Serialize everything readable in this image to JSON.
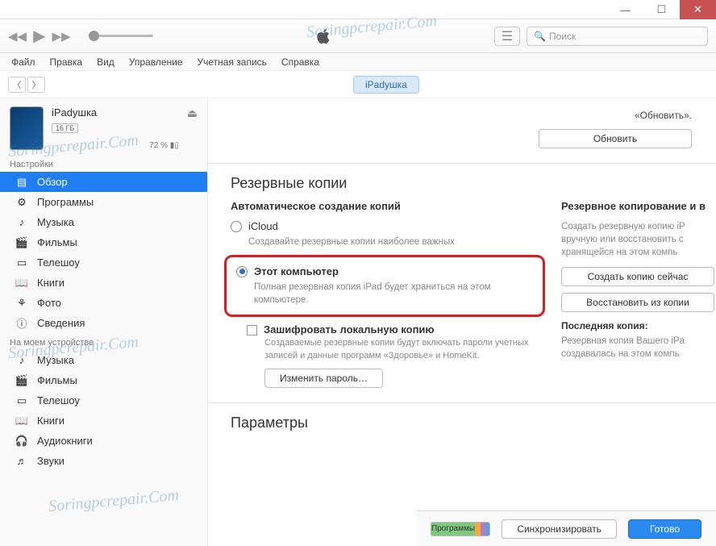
{
  "titlebar": {
    "min": "—",
    "max": "☐",
    "close": "✕"
  },
  "toolbar": {
    "search_placeholder": "Поиск"
  },
  "menu": [
    "Файл",
    "Правка",
    "Вид",
    "Управление",
    "Учетная запись",
    "Справка"
  ],
  "nav": {
    "device_pill": "iPadушка"
  },
  "device": {
    "name": "iPadушка",
    "capacity": "16 ГБ",
    "battery": "72 %"
  },
  "sidebar": {
    "settings_title": "Настройки",
    "settings": [
      {
        "label": "Обзор",
        "icon": "▤"
      },
      {
        "label": "Программы",
        "icon": "⚙"
      },
      {
        "label": "Музыка",
        "icon": "♪"
      },
      {
        "label": "Фильмы",
        "icon": "🎬"
      },
      {
        "label": "Телешоу",
        "icon": "▭"
      },
      {
        "label": "Книги",
        "icon": "📖"
      },
      {
        "label": "Фото",
        "icon": "⚘"
      },
      {
        "label": "Сведения",
        "icon": "ⓘ"
      }
    ],
    "ondevice_title": "На моем устройстве",
    "ondevice": [
      {
        "label": "Музыка",
        "icon": "♪"
      },
      {
        "label": "Фильмы",
        "icon": "🎬"
      },
      {
        "label": "Телешоу",
        "icon": "▭"
      },
      {
        "label": "Книги",
        "icon": "📖"
      },
      {
        "label": "Аудиокниги",
        "icon": "🎧"
      },
      {
        "label": "Звуки",
        "icon": "♬"
      }
    ]
  },
  "content": {
    "update_quote": "«Обновить».",
    "update_btn": "Обновить",
    "backups_header": "Резервные копии",
    "auto_header": "Автоматическое создание копий",
    "icloud_label": "iCloud",
    "icloud_desc": "Создавайте резервные копии наиболее важных",
    "thispc_label": "Этот компьютер",
    "thispc_desc": "Полная резервная копия iPad будет храниться на этом компьютере.",
    "encrypt_label": "Зашифровать локальную копию",
    "encrypt_desc": "Создаваемые резервные копии будут включать пароли учетных записей и данные программ «Здоровье» и HomeKit.",
    "changepwd_btn": "Изменить пароль…",
    "manual_header": "Резервное копирование и в",
    "manual_desc": "Создать резервную копию iP вручную или восстановить с хранящейся на этом компь",
    "backup_now_btn": "Создать копию сейчас",
    "restore_btn": "Восстановить из копии",
    "last_copy_header": "Последняя копия:",
    "last_copy_desc": "Резервная копия Вашего iPa создавалась на этом компь",
    "params_header": "Параметры"
  },
  "footer": {
    "seg_apps": "Программы",
    "sync_btn": "Синхронизировать",
    "done_btn": "Готово"
  },
  "watermark": "Soringpcrepair.Com"
}
